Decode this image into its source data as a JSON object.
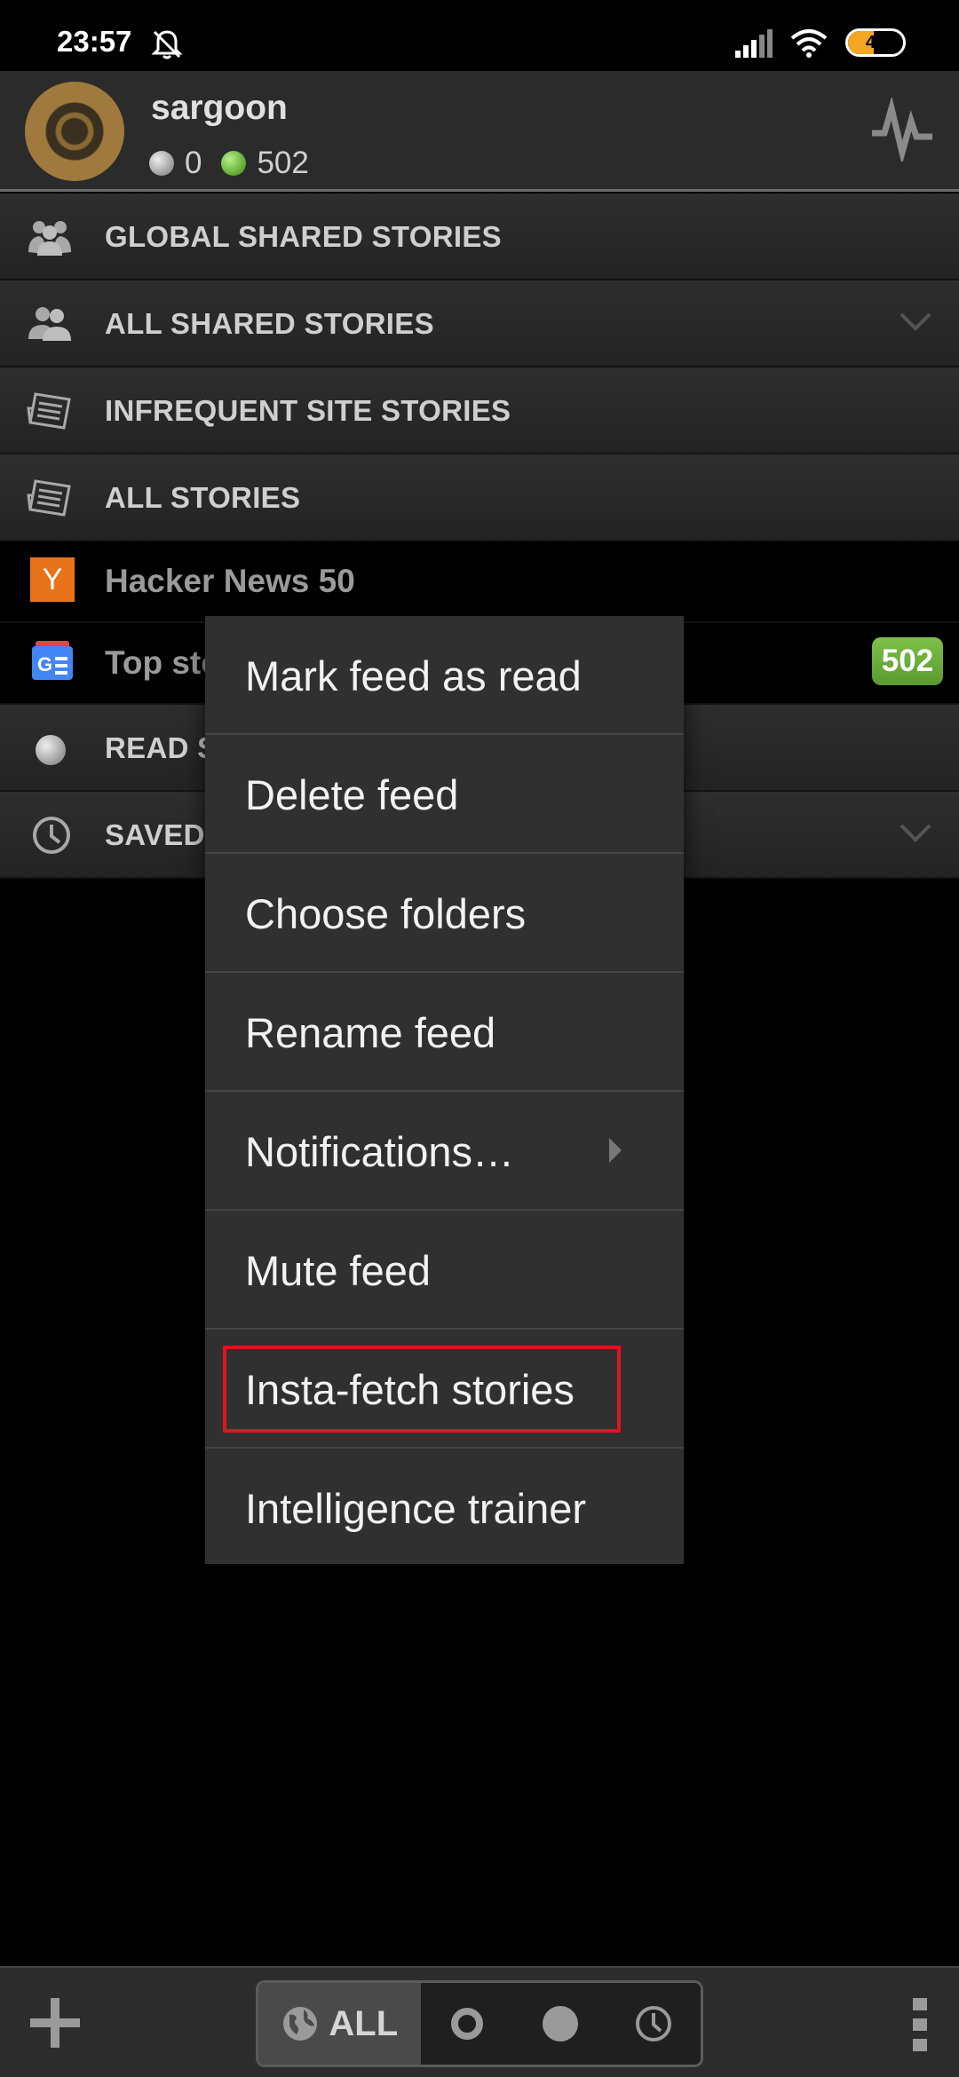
{
  "status_bar": {
    "time": "23:57",
    "battery": "46",
    "battery_level": 0.46
  },
  "profile": {
    "username": "sargoon",
    "read_count": "0",
    "unread_count": "502"
  },
  "list": {
    "folders_top": [
      {
        "label": "GLOBAL SHARED STORIES",
        "icon": "people-group-icon",
        "chevron": false
      },
      {
        "label": "ALL SHARED STORIES",
        "icon": "people-icon",
        "chevron": true
      },
      {
        "label": "INFREQUENT SITE STORIES",
        "icon": "newspaper-icon",
        "chevron": false
      },
      {
        "label": "ALL STORIES",
        "icon": "newspaper-icon",
        "chevron": false
      }
    ],
    "feeds": [
      {
        "label": "Hacker News 50",
        "icon": "hacker-news-icon",
        "icon_text": "Y"
      },
      {
        "label": "Top sto",
        "icon": "google-news-icon",
        "badge": "502"
      }
    ],
    "folders_bottom": [
      {
        "label": "READ S",
        "icon": "read-dot-icon",
        "chevron": false
      },
      {
        "label": "SAVED",
        "icon": "clock-icon",
        "chevron": true
      }
    ]
  },
  "menu": {
    "items": [
      {
        "label": "Mark feed as read"
      },
      {
        "label": "Delete feed"
      },
      {
        "label": "Choose folders"
      },
      {
        "label": "Rename feed"
      },
      {
        "label": "Notifications…",
        "submenu": true
      },
      {
        "label": "Mute feed"
      },
      {
        "label": "Insta-fetch stories",
        "highlighted": true
      },
      {
        "label": "Intelligence trainer"
      }
    ]
  },
  "bottom_bar": {
    "filter_all_label": "ALL"
  },
  "colors": {
    "highlight": "#e0141e",
    "unread_green": "#6aaa3a",
    "hn_orange": "#e8731a"
  }
}
